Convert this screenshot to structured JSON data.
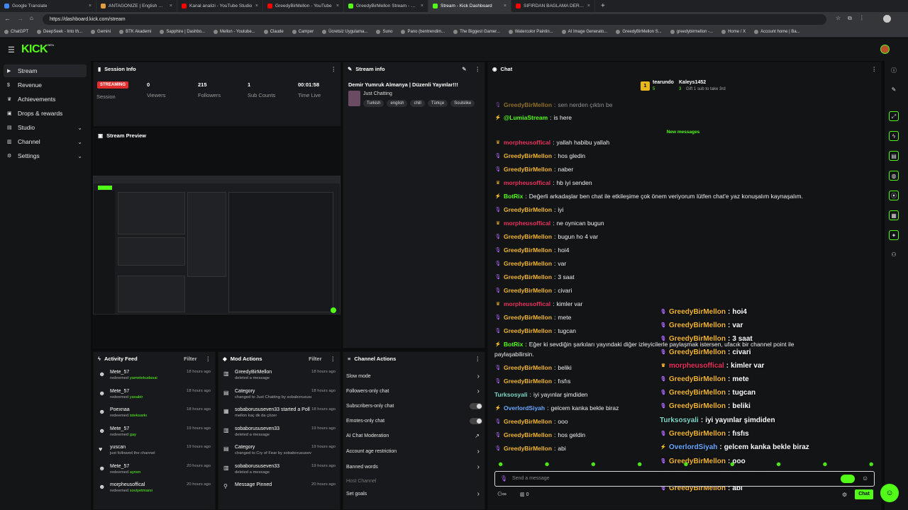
{
  "browser": {
    "tabs": [
      {
        "label": "Google Translate",
        "color": "#4285f4"
      },
      {
        "label": "ANTAGONIZE | English meaning -",
        "color": "#e0a040"
      },
      {
        "label": "Kanal analizi - YouTube Studio",
        "color": "#ff0000"
      },
      {
        "label": "GreedyBirMellon - YouTube",
        "color": "#ff0000"
      },
      {
        "label": "GreedyBirMellon Stream - Watch L",
        "color": "#53fc18"
      },
      {
        "label": "Stream - Kick Dashboard",
        "color": "#53fc18",
        "active": true
      },
      {
        "label": "SIFIRDAN BAĞLAMA DERSİ 3 (EN...",
        "color": "#ff0000"
      }
    ],
    "url": "https://dashboard.kick.com/stream",
    "bookmarks": [
      "ChatGPT",
      "DeepSeek - Into th...",
      "Gemini",
      "BTK Akademi",
      "Sapphire | Dashbo...",
      "Mellon - Youtube...",
      "Claude",
      "Camper",
      "Ücretsiz Uygulama...",
      "Suno",
      "Pano (bentrendim...",
      "The Biggest Gamer...",
      "Watercolor Paintin...",
      "AI Image Generato...",
      "GreedyBirMellon S...",
      "greedybirmellon -...",
      "Home / X",
      "Account home | Ba..."
    ]
  },
  "app": {
    "logo": "KICK",
    "logo_sup": "BETA"
  },
  "sidebar": {
    "items": [
      {
        "label": "Stream",
        "icon": "stream-icon",
        "active": true
      },
      {
        "label": "Revenue",
        "icon": "revenue-icon"
      },
      {
        "label": "Achievements",
        "icon": "trophy-icon"
      },
      {
        "label": "Drops & rewards",
        "icon": "gift-icon"
      },
      {
        "label": "Studio",
        "icon": "studio-icon",
        "chevron": true
      },
      {
        "label": "Channel",
        "icon": "channel-icon",
        "chevron": true
      },
      {
        "label": "Settings",
        "icon": "gear-icon",
        "chevron": true
      }
    ]
  },
  "session": {
    "title": "Session Info",
    "status": "STREAMING",
    "status_label": "Session",
    "viewers": "0",
    "viewers_label": "Viewers",
    "followers": "215",
    "followers_label": "Followers",
    "subs": "1",
    "subs_label": "Sub Counts",
    "time": "00:01:58",
    "time_label": "Time Live"
  },
  "preview": {
    "title": "Stream Preview"
  },
  "stream_info": {
    "title": "Stream info",
    "stream_title": "Demir Yumruk Almanya | Düzenli Yayınlar!!!",
    "category": "Just Chatting",
    "tags": [
      "Turkish",
      "english",
      "chill",
      "Türkçe",
      "Soulslike"
    ]
  },
  "activity": {
    "title": "Activity Feed",
    "filter": "Filter",
    "items": [
      {
        "name": "Mete_57",
        "action": "redeemed",
        "item": "yametekudasai",
        "time": "18 hours ago"
      },
      {
        "name": "Mete_57",
        "action": "redeemed",
        "item": "yasabir",
        "time": "18 hours ago"
      },
      {
        "name": "Poexnaa",
        "action": "redeemed",
        "item": "isteksarkı",
        "time": "18 hours ago"
      },
      {
        "name": "Mete_57",
        "action": "redeemed",
        "item": "gay",
        "time": "19 hours ago"
      },
      {
        "name": "yuscan",
        "action": "just followed the channel",
        "item": "",
        "time": "19 hours ago"
      },
      {
        "name": "Mete_57",
        "action": "redeemed",
        "item": "aynen",
        "time": "20 hours ago"
      },
      {
        "name": "morpheusoffical",
        "action": "redeemed",
        "item": "soviyetmarsi",
        "time": "20 hours ago"
      }
    ]
  },
  "mod": {
    "title": "Mod Actions",
    "filter": "Filter",
    "items": [
      {
        "name": "GreedyBirMellon",
        "line2": "deleted a message",
        "time": "18 hours ago"
      },
      {
        "name": "Category",
        "line2": "changed to Just Chatting by sobaborususeven33",
        "time": "18 hours ago"
      },
      {
        "name": "sobaborususeven33 started a Poll",
        "line2": "mellon kaç dk da çözer",
        "time": "18 hours ago"
      },
      {
        "name": "sobaborususeven33",
        "line2": "deleted a message",
        "time": "19 hours ago"
      },
      {
        "name": "Category",
        "line2": "changed to Cry of Fear by sobaborususeven33",
        "time": "19 hours ago"
      },
      {
        "name": "sobaborususeven33",
        "line2": "deleted a message",
        "time": "19 hours ago"
      },
      {
        "name": "Message Pinned",
        "line2": "",
        "time": "20 hours ago"
      }
    ]
  },
  "channel_actions": {
    "title": "Channel Actions",
    "items": [
      "Slow mode",
      "Followers-only chat",
      "Subscribers-only chat",
      "Emotes-only chat",
      "AI Chat Moderation",
      "Account age restriction",
      "Banned words",
      "Host Channel",
      "Set goals"
    ]
  },
  "chat": {
    "title": "Chat",
    "top1_name": "tearundo",
    "top1_count": "5",
    "top2_name": "Kaleys1452",
    "top2_count": "3",
    "gift_text": "Gift 1 sub to take 3rd",
    "new_messages": "New messages",
    "input_placeholder": "Send a message",
    "send_label": "Chat",
    "bottom_count": "0",
    "messages": [
      {
        "user": "GreedyBirMellon",
        "color": "#f2b632",
        "badge": "mic",
        "text": "sen nerden çıktın be"
      },
      {
        "user": "@LumiaStream",
        "color": "#53fc18",
        "badge": "bot",
        "text": "is here"
      },
      {
        "user": "morpheusoffical",
        "color": "#e8315d",
        "badge": "crown",
        "text": "yallah habibu yallah"
      },
      {
        "user": "GreedyBirMellon",
        "color": "#f2b632",
        "badge": "mic",
        "text": "hos gledin"
      },
      {
        "user": "GreedyBirMellon",
        "color": "#f2b632",
        "badge": "mic",
        "text": "naber"
      },
      {
        "user": "morpheusoffical",
        "color": "#e8315d",
        "badge": "crown",
        "text": "hb iyi senden"
      },
      {
        "user": "BotRix",
        "color": "#53fc18",
        "badge": "bot",
        "text": "Değerli arkadaşlar ben chat ile etkileşime çok önem veriyorum lütfen chat'e yaz konuşalım kaynaşalım."
      },
      {
        "user": "GreedyBirMellon",
        "color": "#f2b632",
        "badge": "mic",
        "text": "iyi"
      },
      {
        "user": "morpheusoffical",
        "color": "#e8315d",
        "badge": "crown",
        "text": "ne oynican bugun"
      },
      {
        "user": "GreedyBirMellon",
        "color": "#f2b632",
        "badge": "mic",
        "text": "bugun ho 4 var"
      },
      {
        "user": "GreedyBirMellon",
        "color": "#f2b632",
        "badge": "mic",
        "text": "hoi4"
      },
      {
        "user": "GreedyBirMellon",
        "color": "#f2b632",
        "badge": "mic",
        "text": "var"
      },
      {
        "user": "GreedyBirMellon",
        "color": "#f2b632",
        "badge": "mic",
        "text": "3 saat"
      },
      {
        "user": "GreedyBirMellon",
        "color": "#f2b632",
        "badge": "mic",
        "text": "civari"
      },
      {
        "user": "morpheusoffical",
        "color": "#e8315d",
        "badge": "crown",
        "text": "kimler var"
      },
      {
        "user": "GreedyBirMellon",
        "color": "#f2b632",
        "badge": "mic",
        "text": "mete"
      },
      {
        "user": "GreedyBirMellon",
        "color": "#f2b632",
        "badge": "mic",
        "text": "tugcan"
      },
      {
        "user": "BotRix",
        "color": "#53fc18",
        "badge": "bot",
        "text": "Eğer ki sevdiğin şarkıları yayındaki diğer izleyicilerle paylaşmak istersen, ufacık bir channel point ile",
        "text2": "paylaşabilirsin."
      },
      {
        "user": "GreedyBirMellon",
        "color": "#f2b632",
        "badge": "mic",
        "text": "beliki"
      },
      {
        "user": "GreedyBirMellon",
        "color": "#f2b632",
        "badge": "mic",
        "text": "fısfıs"
      },
      {
        "user": "Turksosyali",
        "color": "#7ed6c5",
        "badge": "",
        "text": "iyi yayınlar şimdiden"
      },
      {
        "user": "OverlordSiyah",
        "color": "#6aa8ff",
        "badge": "bot",
        "text": "gelcem kanka bekle biraz"
      },
      {
        "user": "GreedyBirMellon",
        "color": "#f2b632",
        "badge": "mic",
        "text": "ooo"
      },
      {
        "user": "GreedyBirMellon",
        "color": "#f2b632",
        "badge": "mic",
        "text": "hos geldin"
      },
      {
        "user": "GreedyBirMellon",
        "color": "#f2b632",
        "badge": "mic",
        "text": "abi"
      }
    ],
    "overlay": [
      {
        "user": "GreedyBirMellon",
        "color": "#f2b632",
        "badge": "mic",
        "text": "hoi4"
      },
      {
        "user": "GreedyBirMellon",
        "color": "#f2b632",
        "badge": "mic",
        "text": "var"
      },
      {
        "user": "GreedyBirMellon",
        "color": "#f2b632",
        "badge": "mic",
        "text": "3 saat"
      },
      {
        "user": "GreedyBirMellon",
        "color": "#f2b632",
        "badge": "mic",
        "text": "civari"
      },
      {
        "user": "morpheusoffical",
        "color": "#e8315d",
        "badge": "crown",
        "text": "kimler var"
      },
      {
        "user": "GreedyBirMellon",
        "color": "#f2b632",
        "badge": "mic",
        "text": "mete"
      },
      {
        "user": "GreedyBirMellon",
        "color": "#f2b632",
        "badge": "mic",
        "text": "tugcan"
      },
      {
        "user": "GreedyBirMellon",
        "color": "#f2b632",
        "badge": "mic",
        "text": "beliki"
      },
      {
        "user": "Turksosyali",
        "color": "#7ed6c5",
        "badge": "",
        "text": "iyi yayınlar şimdiden"
      },
      {
        "user": "GreedyBirMellon",
        "color": "#f2b632",
        "badge": "mic",
        "text": "fısfıs"
      },
      {
        "user": "OverlordSiyah",
        "color": "#6aa8ff",
        "badge": "bot",
        "text": "gelcem kanka bekle biraz"
      },
      {
        "user": "GreedyBirMellon",
        "color": "#f2b632",
        "badge": "mic",
        "text": "ooo"
      },
      {
        "user": "GreedyBirMellon",
        "color": "#f2b632",
        "badge": "mic",
        "text": "hos geldin"
      },
      {
        "user": "GreedyBirMellon",
        "color": "#f2b632",
        "badge": "mic",
        "text": "abi"
      }
    ]
  },
  "colors": {
    "accent": "#53fc18",
    "live": "#e32e2e",
    "bg": "#0b0c0e",
    "panel": "#18191c"
  }
}
